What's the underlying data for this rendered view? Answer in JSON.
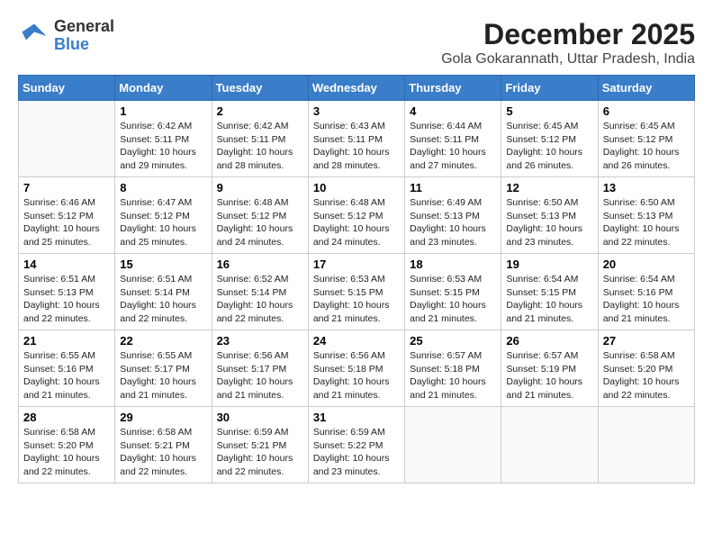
{
  "logo": {
    "general": "General",
    "blue": "Blue"
  },
  "title": "December 2025",
  "subtitle": "Gola Gokarannath, Uttar Pradesh, India",
  "days_of_week": [
    "Sunday",
    "Monday",
    "Tuesday",
    "Wednesday",
    "Thursday",
    "Friday",
    "Saturday"
  ],
  "weeks": [
    [
      {
        "day": "",
        "empty": true
      },
      {
        "day": "1",
        "sunrise": "Sunrise: 6:42 AM",
        "sunset": "Sunset: 5:11 PM",
        "daylight": "Daylight: 10 hours and 29 minutes."
      },
      {
        "day": "2",
        "sunrise": "Sunrise: 6:42 AM",
        "sunset": "Sunset: 5:11 PM",
        "daylight": "Daylight: 10 hours and 28 minutes."
      },
      {
        "day": "3",
        "sunrise": "Sunrise: 6:43 AM",
        "sunset": "Sunset: 5:11 PM",
        "daylight": "Daylight: 10 hours and 28 minutes."
      },
      {
        "day": "4",
        "sunrise": "Sunrise: 6:44 AM",
        "sunset": "Sunset: 5:11 PM",
        "daylight": "Daylight: 10 hours and 27 minutes."
      },
      {
        "day": "5",
        "sunrise": "Sunrise: 6:45 AM",
        "sunset": "Sunset: 5:12 PM",
        "daylight": "Daylight: 10 hours and 26 minutes."
      },
      {
        "day": "6",
        "sunrise": "Sunrise: 6:45 AM",
        "sunset": "Sunset: 5:12 PM",
        "daylight": "Daylight: 10 hours and 26 minutes."
      }
    ],
    [
      {
        "day": "7",
        "sunrise": "Sunrise: 6:46 AM",
        "sunset": "Sunset: 5:12 PM",
        "daylight": "Daylight: 10 hours and 25 minutes."
      },
      {
        "day": "8",
        "sunrise": "Sunrise: 6:47 AM",
        "sunset": "Sunset: 5:12 PM",
        "daylight": "Daylight: 10 hours and 25 minutes."
      },
      {
        "day": "9",
        "sunrise": "Sunrise: 6:48 AM",
        "sunset": "Sunset: 5:12 PM",
        "daylight": "Daylight: 10 hours and 24 minutes."
      },
      {
        "day": "10",
        "sunrise": "Sunrise: 6:48 AM",
        "sunset": "Sunset: 5:12 PM",
        "daylight": "Daylight: 10 hours and 24 minutes."
      },
      {
        "day": "11",
        "sunrise": "Sunrise: 6:49 AM",
        "sunset": "Sunset: 5:13 PM",
        "daylight": "Daylight: 10 hours and 23 minutes."
      },
      {
        "day": "12",
        "sunrise": "Sunrise: 6:50 AM",
        "sunset": "Sunset: 5:13 PM",
        "daylight": "Daylight: 10 hours and 23 minutes."
      },
      {
        "day": "13",
        "sunrise": "Sunrise: 6:50 AM",
        "sunset": "Sunset: 5:13 PM",
        "daylight": "Daylight: 10 hours and 22 minutes."
      }
    ],
    [
      {
        "day": "14",
        "sunrise": "Sunrise: 6:51 AM",
        "sunset": "Sunset: 5:13 PM",
        "daylight": "Daylight: 10 hours and 22 minutes."
      },
      {
        "day": "15",
        "sunrise": "Sunrise: 6:51 AM",
        "sunset": "Sunset: 5:14 PM",
        "daylight": "Daylight: 10 hours and 22 minutes."
      },
      {
        "day": "16",
        "sunrise": "Sunrise: 6:52 AM",
        "sunset": "Sunset: 5:14 PM",
        "daylight": "Daylight: 10 hours and 22 minutes."
      },
      {
        "day": "17",
        "sunrise": "Sunrise: 6:53 AM",
        "sunset": "Sunset: 5:15 PM",
        "daylight": "Daylight: 10 hours and 21 minutes."
      },
      {
        "day": "18",
        "sunrise": "Sunrise: 6:53 AM",
        "sunset": "Sunset: 5:15 PM",
        "daylight": "Daylight: 10 hours and 21 minutes."
      },
      {
        "day": "19",
        "sunrise": "Sunrise: 6:54 AM",
        "sunset": "Sunset: 5:15 PM",
        "daylight": "Daylight: 10 hours and 21 minutes."
      },
      {
        "day": "20",
        "sunrise": "Sunrise: 6:54 AM",
        "sunset": "Sunset: 5:16 PM",
        "daylight": "Daylight: 10 hours and 21 minutes."
      }
    ],
    [
      {
        "day": "21",
        "sunrise": "Sunrise: 6:55 AM",
        "sunset": "Sunset: 5:16 PM",
        "daylight": "Daylight: 10 hours and 21 minutes."
      },
      {
        "day": "22",
        "sunrise": "Sunrise: 6:55 AM",
        "sunset": "Sunset: 5:17 PM",
        "daylight": "Daylight: 10 hours and 21 minutes."
      },
      {
        "day": "23",
        "sunrise": "Sunrise: 6:56 AM",
        "sunset": "Sunset: 5:17 PM",
        "daylight": "Daylight: 10 hours and 21 minutes."
      },
      {
        "day": "24",
        "sunrise": "Sunrise: 6:56 AM",
        "sunset": "Sunset: 5:18 PM",
        "daylight": "Daylight: 10 hours and 21 minutes."
      },
      {
        "day": "25",
        "sunrise": "Sunrise: 6:57 AM",
        "sunset": "Sunset: 5:18 PM",
        "daylight": "Daylight: 10 hours and 21 minutes."
      },
      {
        "day": "26",
        "sunrise": "Sunrise: 6:57 AM",
        "sunset": "Sunset: 5:19 PM",
        "daylight": "Daylight: 10 hours and 21 minutes."
      },
      {
        "day": "27",
        "sunrise": "Sunrise: 6:58 AM",
        "sunset": "Sunset: 5:20 PM",
        "daylight": "Daylight: 10 hours and 22 minutes."
      }
    ],
    [
      {
        "day": "28",
        "sunrise": "Sunrise: 6:58 AM",
        "sunset": "Sunset: 5:20 PM",
        "daylight": "Daylight: 10 hours and 22 minutes."
      },
      {
        "day": "29",
        "sunrise": "Sunrise: 6:58 AM",
        "sunset": "Sunset: 5:21 PM",
        "daylight": "Daylight: 10 hours and 22 minutes."
      },
      {
        "day": "30",
        "sunrise": "Sunrise: 6:59 AM",
        "sunset": "Sunset: 5:21 PM",
        "daylight": "Daylight: 10 hours and 22 minutes."
      },
      {
        "day": "31",
        "sunrise": "Sunrise: 6:59 AM",
        "sunset": "Sunset: 5:22 PM",
        "daylight": "Daylight: 10 hours and 23 minutes."
      },
      {
        "day": "",
        "empty": true
      },
      {
        "day": "",
        "empty": true
      },
      {
        "day": "",
        "empty": true
      }
    ]
  ],
  "accent_color": "#3a7dc9"
}
